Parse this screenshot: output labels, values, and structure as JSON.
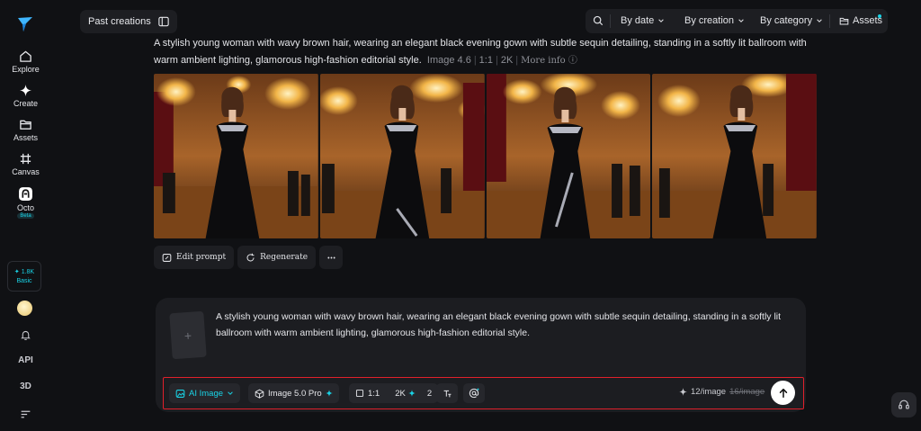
{
  "sidebar": {
    "items": [
      {
        "label": "Explore",
        "icon": "home-icon"
      },
      {
        "label": "Create",
        "icon": "sparkle-icon"
      },
      {
        "label": "Assets",
        "icon": "folder-icon"
      },
      {
        "label": "Canvas",
        "icon": "canvas-icon"
      },
      {
        "label": "Octo",
        "icon": "octo-icon",
        "badge": "Beta"
      }
    ],
    "credits": {
      "amount": "1.8K",
      "plan": "Basic"
    },
    "api_label": "API",
    "three_d_label": "3D"
  },
  "topbar": {
    "past_creations": "Past creations",
    "filters": [
      "By date",
      "By creation",
      "By category",
      "Assets"
    ]
  },
  "result": {
    "prompt": "A stylish young woman with wavy brown hair, wearing an elegant black evening gown with subtle sequin detailing, standing in a softly lit ballroom with warm ambient lighting, glamorous high-fashion editorial style.",
    "model": "Image 4.6",
    "ratio": "1:1",
    "resolution": "2K",
    "more_info": "More info",
    "actions": [
      "Edit prompt",
      "Regenerate"
    ]
  },
  "composer": {
    "prompt": "A stylish young woman with wavy brown hair, wearing an elegant black evening gown with subtle sequin detailing, standing in a softly lit ballroom with warm ambient lighting, glamorous high-fashion editorial style.",
    "mode": "AI Image",
    "model": "Image 5.0 Pro",
    "ratio": "1:1",
    "resolution": "2K",
    "count": "2",
    "cost": "12/image",
    "original_cost": "16/image"
  },
  "colors": {
    "accent": "#19d3e6",
    "highlight_border": "#e0202b",
    "background": "#101114"
  }
}
